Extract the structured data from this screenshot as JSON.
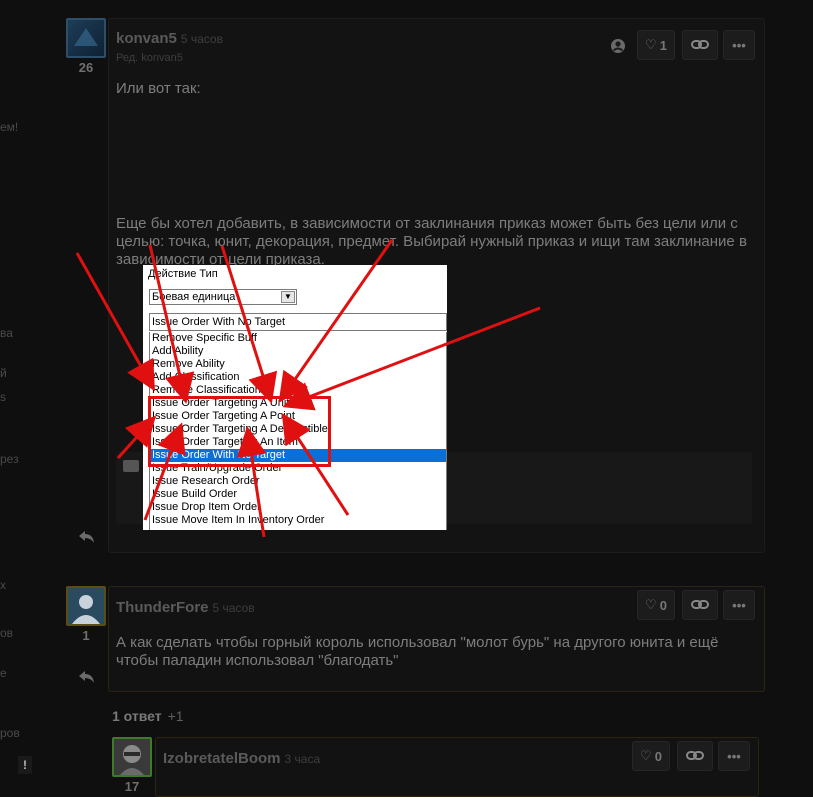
{
  "left_fragments": [
    "ем!",
    "ва",
    "й",
    "s",
    "рез",
    "х",
    "ов",
    "е",
    "ров",
    "!"
  ],
  "post1": {
    "author": "konvan5",
    "time": "5 часов",
    "edited": "Ред. konvan5",
    "reputation": "26",
    "likes": "1",
    "text1": "Или вот так:",
    "text2": "Еще бы хотел добавить, в зависимости от заклинания приказ может быть без цели или с целью: точка, юнит, декорация, предмет. Выбирай нужный приказ и ищи там заклинание в зависимости от цели приказа."
  },
  "screenshot": {
    "label": "Действие Тип",
    "dropdown_value": "Боевая единица",
    "combo_value": "Issue Order With No Target",
    "items": [
      "Remove Specific Buff",
      "Add Ability",
      "Remove Ability",
      "Add Classification",
      "Remove Classification",
      "Issue Order Targeting A Unit",
      "Issue Order Targeting A Point",
      "Issue Order Targeting A Destructible",
      "Issue Order Targeting An Item",
      "Issue Order With No Target",
      "Issue Train/Upgrade Order",
      "Issue Research Order",
      "Issue Build Order",
      "Issue Drop Item Order",
      "Issue Move Item In Inventory Order"
    ],
    "selected_index": 9
  },
  "post2": {
    "author": "ThunderFore",
    "time": "5 часов",
    "reputation": "1",
    "likes": "0",
    "text": "А как сделать чтобы горный король использовал \"молот бурь\" на другого юнита и ещё чтобы паладин использовал \"благодать\""
  },
  "answers": {
    "label": "1 ответ",
    "more": "+1"
  },
  "post3": {
    "author": "IzobretatelBoom",
    "time": "3 часа",
    "reputation": "17",
    "likes": "0"
  },
  "colors": {
    "accent_red": "#e01010",
    "selection_blue": "#0a6fd6"
  }
}
